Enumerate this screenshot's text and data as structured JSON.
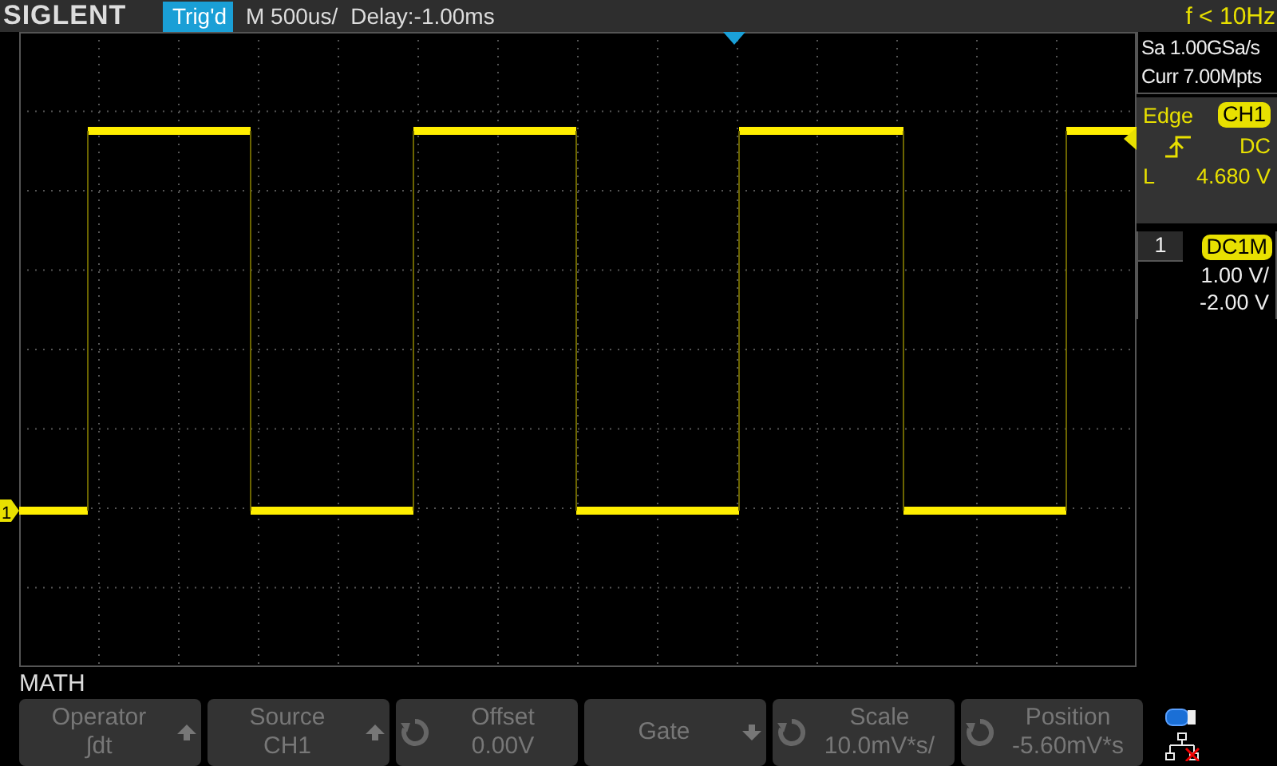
{
  "header": {
    "logo": "SIGLENT",
    "trigger_status": "Trig'd",
    "timebase": "M 500us/",
    "delay": "Delay:-1.00ms",
    "frequency": "f < 10Hz"
  },
  "waveform": {
    "channel_marker": "1"
  },
  "acquisition": {
    "sample_rate": "Sa 1.00GSa/s",
    "memory_depth": "Curr 7.00Mpts"
  },
  "trigger": {
    "type": "Edge",
    "source": "CH1",
    "coupling": "DC",
    "level_label": "L",
    "level": "4.680 V"
  },
  "channel": {
    "number": "1",
    "coupling": "DC1M",
    "scale": "1.00 V/",
    "offset": "-2.00 V"
  },
  "menu": {
    "title": "MATH",
    "softkeys": [
      {
        "label": "Operator",
        "value": "∫dt",
        "kind": "up"
      },
      {
        "label": "Source",
        "value": "CH1",
        "kind": "up"
      },
      {
        "label": "Offset",
        "value": "0.00V",
        "kind": "knob"
      },
      {
        "label": "Gate",
        "kind": "down"
      },
      {
        "label": "Scale",
        "value": "10.0mV*s/",
        "kind": "knob"
      },
      {
        "label": "Position",
        "value": "-5.60mV*s",
        "kind": "knob"
      }
    ]
  }
}
